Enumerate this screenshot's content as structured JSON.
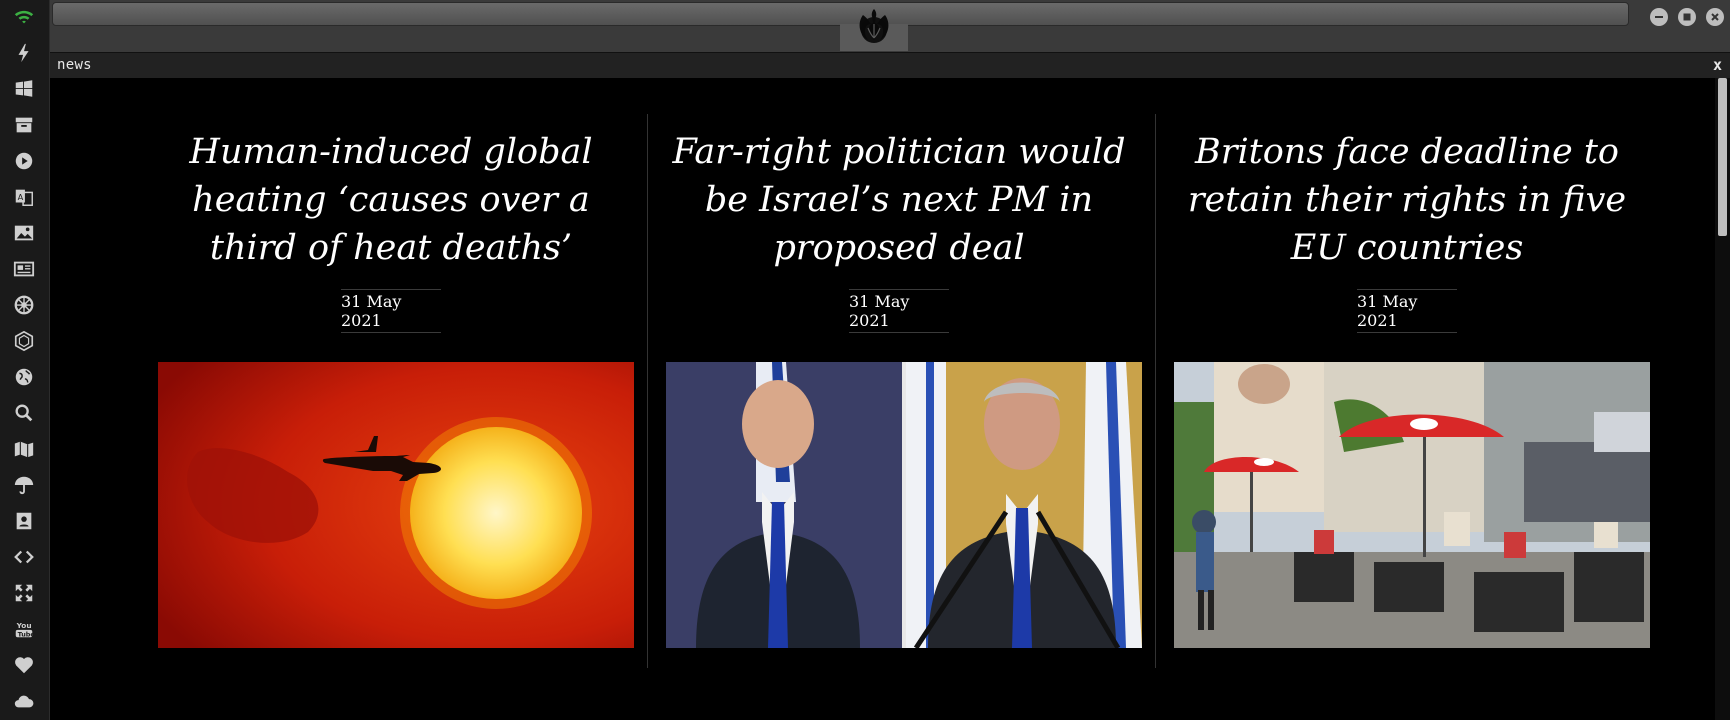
{
  "app": {
    "tab_label": "news",
    "tab_close": "x"
  },
  "dock": {
    "icons": [
      "wifi-icon",
      "lightning-icon",
      "windows-icon",
      "archive-icon",
      "play-icon",
      "translate-icon",
      "image-icon",
      "newspaper-icon",
      "empire-icon",
      "hexagon-icon",
      "globe-icon",
      "search-icon",
      "map-icon",
      "umbrella-icon",
      "contacts-icon",
      "code-icon",
      "expand-icon",
      "youtube-icon",
      "heart-icon",
      "cloud-icon"
    ]
  },
  "articles": [
    {
      "headline": "Human-induced global heating ‘causes over a third of heat deaths’",
      "date": "31 May 2021",
      "image": "plane-and-sun-photo"
    },
    {
      "headline": "Far-right politician would be Israel’s next PM in proposed deal",
      "date": "31 May 2021",
      "image": "two-politicians-photo"
    },
    {
      "headline": "Britons face deadline to retain their rights in five EU countries",
      "date": "31 May 2021",
      "image": "cafe-street-photo"
    }
  ],
  "colors": {
    "accent_wifi": "#3cb043",
    "background": "#000000",
    "text": "#ffffff"
  }
}
